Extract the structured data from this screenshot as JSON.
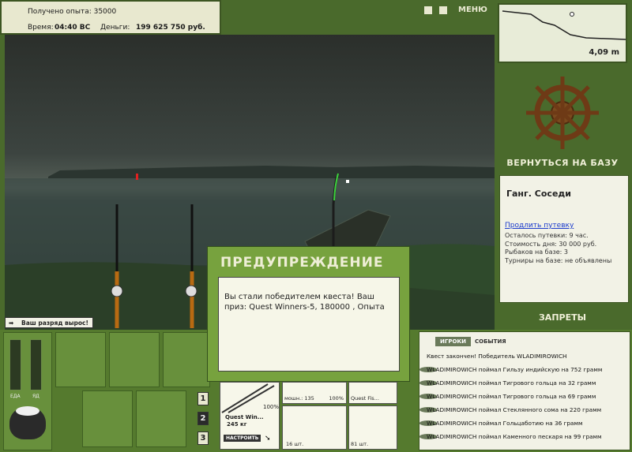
{
  "info": {
    "exp_line": "Получено опыта: 35000",
    "time_label": "Время:",
    "time_value": "04:40 ВС",
    "money_label": "Деньги:",
    "money_value": "199 625 750 руб."
  },
  "top_controls": {
    "pause_icon": "pause-icon",
    "sound_icon": "sound-icon",
    "menu_label": "МЕНЮ"
  },
  "depth": {
    "value": "4,09 m"
  },
  "base": {
    "return_label": "ВЕРНУТЬСЯ НА БАЗУ",
    "name": "Ганг. Соседи",
    "extend_link": "Продлить путевку",
    "lines": [
      "Осталось путевки: 9 час.",
      "Стоимость дня: 30 000 руб.",
      "Рыбаков на базе: 3",
      "Турниры на базе: не объявлены"
    ],
    "bans_label": "ЗАПРЕТЫ"
  },
  "rank": {
    "text": "Ваш разряд вырос!"
  },
  "warning": {
    "title": "ПРЕДУПРЕЖДЕНИЕ",
    "message": "Вы стали победителем квеста! Ваш приз: Quest Winners-5, 180000 , Опыта"
  },
  "bottom": {
    "food_label": "ЕДА",
    "poison_label": "ЯД",
    "levels": [
      "1",
      "2",
      "3"
    ],
    "rod_name": "Quest Win...",
    "rod_weight": "245 кг",
    "rod_pct": "100%",
    "setup_label": "НАСТРОИТЬ",
    "item1_label": "мошн.: 135",
    "item1_pct": "100%",
    "item2_label": "Quest Fis...",
    "item3_label": "16 шт.",
    "item4_label": "81 шт."
  },
  "events": {
    "tab_players": "ИГРОКИ",
    "tab_events": "СОБЫТИЯ",
    "rows": [
      "Квест закончен! Победитель WLADIMIROWICH",
      "WLADIMIROWICH поймал Гильзу индийскую на 752 грамм",
      "WLADIMIROWICH поймал Тигрового гольца на 32 грамм",
      "WLADIMIROWICH поймал Тигрового гольца на 69 грамм",
      "WLADIMIROWICH поймал Стеклянного сома на 220 грамм",
      "WLADIMIROWICH поймал Гольцаботию на 36 грамм",
      "WLADIMIROWICH поймал Каменного пескаря на 99 грамм"
    ]
  }
}
